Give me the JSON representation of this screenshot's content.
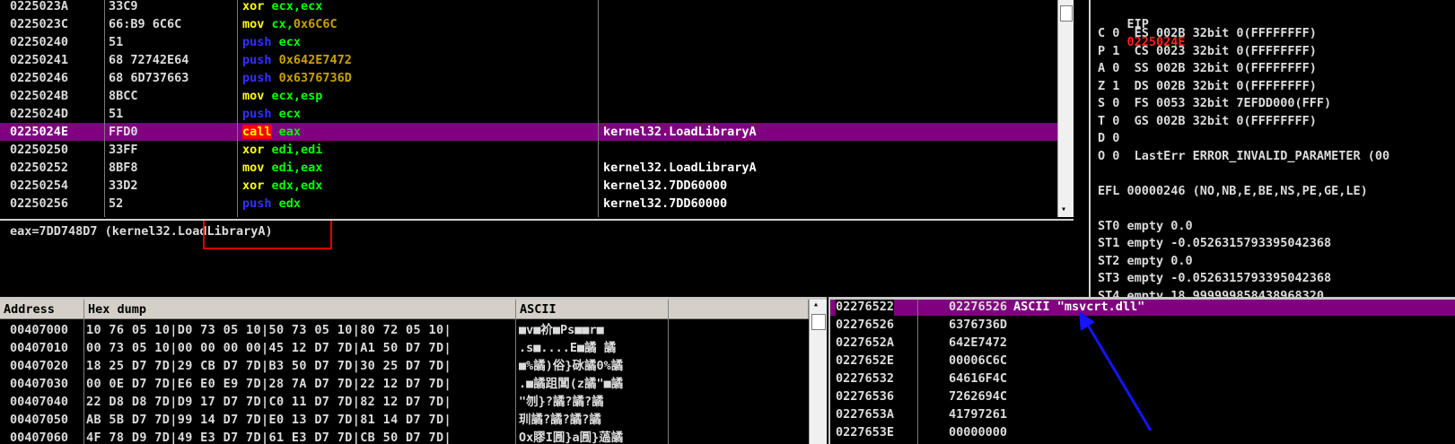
{
  "disasm": [
    {
      "addr": "0225023A",
      "hex": "33C9",
      "mn": [
        [
          "xor",
          "#ffff00"
        ],
        [
          " ecx,ecx",
          "#00ff00"
        ]
      ],
      "comment": ""
    },
    {
      "addr": "0225023C",
      "hex": "66:B9 6C6C",
      "mn": [
        [
          "mov",
          "#ffff00"
        ],
        [
          " cx,",
          "#00ff00"
        ],
        [
          "0x6C6C",
          "#c8a000"
        ]
      ],
      "comment": ""
    },
    {
      "addr": "02250240",
      "hex": "51",
      "mn": [
        [
          "push",
          "#3030ff"
        ],
        [
          " ecx",
          "#00ff00"
        ]
      ],
      "comment": ""
    },
    {
      "addr": "02250241",
      "hex": "68 72742E64",
      "mn": [
        [
          "push",
          "#3030ff"
        ],
        [
          " 0x642E7472",
          "#c8a000"
        ]
      ],
      "comment": ""
    },
    {
      "addr": "02250246",
      "hex": "68 6D737663",
      "mn": [
        [
          "push",
          "#3030ff"
        ],
        [
          " 0x6376736D",
          "#c8a000"
        ]
      ],
      "comment": ""
    },
    {
      "addr": "0225024B",
      "hex": "8BCC",
      "mn": [
        [
          "mov",
          "#ffff00"
        ],
        [
          " ecx,esp",
          "#00ff00"
        ]
      ],
      "comment": ""
    },
    {
      "addr": "0225024D",
      "hex": "51",
      "mn": [
        [
          "push",
          "#3030ff"
        ],
        [
          " ecx",
          "#00ff00"
        ]
      ],
      "comment": ""
    },
    {
      "addr": "0225024E",
      "hex": "FFD0",
      "mn": [
        [
          "call",
          "#ffff00",
          "#ff0000"
        ],
        [
          " eax",
          "#00ff00"
        ]
      ],
      "comment": "kernel32.LoadLibraryA",
      "selected": true
    },
    {
      "addr": "02250250",
      "hex": "33FF",
      "mn": [
        [
          "xor",
          "#ffff00"
        ],
        [
          " edi,edi",
          "#00ff00"
        ]
      ],
      "comment": ""
    },
    {
      "addr": "02250252",
      "hex": "8BF8",
      "mn": [
        [
          "mov",
          "#ffff00"
        ],
        [
          " edi,eax",
          "#00ff00"
        ]
      ],
      "comment": "kernel32.LoadLibraryA"
    },
    {
      "addr": "02250254",
      "hex": "33D2",
      "mn": [
        [
          "xor",
          "#ffff00"
        ],
        [
          " edx,edx",
          "#00ff00"
        ]
      ],
      "comment": "kernel32.7DD60000"
    },
    {
      "addr": "02250256",
      "hex": "52",
      "mn": [
        [
          "push",
          "#3030ff"
        ],
        [
          " edx",
          "#00ff00"
        ]
      ],
      "comment": "kernel32.7DD60000"
    }
  ],
  "info_line": "eax=7DD748D7 (kernel32.LoadLibraryA)",
  "registers": {
    "eip_label": "EIP",
    "eip_value": "0225024E",
    "lines": [
      "C 0  ES 002B 32bit 0(FFFFFFFF)",
      "P 1  CS 0023 32bit 0(FFFFFFFF)",
      "A 0  SS 002B 32bit 0(FFFFFFFF)",
      "Z 1  DS 002B 32bit 0(FFFFFFFF)",
      "S 0  FS 0053 32bit 7EFDD000(FFF)",
      "T 0  GS 002B 32bit 0(FFFFFFFF)",
      "D 0",
      "O 0  LastErr ERROR_INVALID_PARAMETER (00",
      "",
      "EFL 00000246 (NO,NB,E,BE,NS,PE,GE,LE)",
      "",
      "ST0 empty 0.0",
      "ST1 empty -0.0526315793395042368",
      "ST2 empty 0.0",
      "ST3 empty -0.0526315793395042368",
      "ST4 empty 18.999999858438968320"
    ]
  },
  "dump": {
    "headers": {
      "address": "Address",
      "hex": "Hex dump",
      "ascii": "ASCII"
    },
    "rows": [
      {
        "addr": "00407000",
        "hex": "10 76 05 10|D0 73 05 10|50 73 05 10|80 72 05 10|",
        "ascii": "■v■衸■Ps■■r■"
      },
      {
        "addr": "00407010",
        "hex": "00 73 05 10|00 00 00 00|45 12 D7 7D|A1 50 D7 7D|",
        "ascii": ".s■....E■譎 譎"
      },
      {
        "addr": "00407020",
        "hex": "18 25 D7 7D|29 CB D7 7D|B3 50 D7 7D|30 25 D7 7D|",
        "ascii": "■%譎)俗}砯譎0%譎"
      },
      {
        "addr": "00407030",
        "hex": "00 0E D7 7D|E6 E0 E9 7D|28 7A D7 7D|22 12 D7 7D|",
        "ascii": ".■譎跙閶(z譎\"■譎"
      },
      {
        "addr": "00407040",
        "hex": "22 D8 D8 7D|D9 17 D7 7D|C0 11 D7 7D|82 12 D7 7D|",
        "ascii": "\"刎}?譎?譎?譎"
      },
      {
        "addr": "00407050",
        "hex": "AB 5B D7 7D|99 14 D7 7D|E0 13 D7 7D|81 14 D7 7D|",
        "ascii": "玔譎?譎?譎?譎"
      },
      {
        "addr": "00407060",
        "hex": "4F 78 D9 7D|49 E3 D7 7D|61 E3 D7 7D|CB 50 D7 7D|",
        "ascii": "Ox賿I㘣}a㘣}薖譎"
      }
    ]
  },
  "stack": [
    {
      "addr": "02276522",
      "val": "02276526",
      "comment": "ASCII \"msvcrt.dll\"",
      "selected": true
    },
    {
      "addr": "02276526",
      "val": "6376736D",
      "comment": ""
    },
    {
      "addr": "0227652A",
      "val": "642E7472",
      "comment": ""
    },
    {
      "addr": "0227652E",
      "val": "00006C6C",
      "comment": ""
    },
    {
      "addr": "02276532",
      "val": "64616F4C",
      "comment": ""
    },
    {
      "addr": "02276536",
      "val": "7262694C",
      "comment": ""
    },
    {
      "addr": "0227653A",
      "val": "41797261",
      "comment": ""
    },
    {
      "addr": "0227653E",
      "val": "00000000",
      "comment": ""
    }
  ],
  "colors": {
    "selection": "#800080",
    "eip": "#ff2020",
    "annotation_box": "#e00000",
    "arrow": "#1414ff"
  }
}
